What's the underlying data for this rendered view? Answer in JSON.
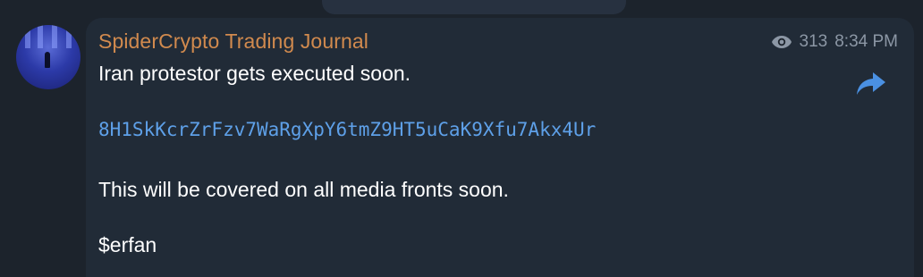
{
  "message": {
    "sender": "SpiderCrypto Trading Journal",
    "views": "313",
    "time": "8:34 PM",
    "lines": {
      "line1": "Iran protestor gets executed soon.",
      "address": "8H1SkKcrZrFzv7WaRgXpY6tmZ9HT5uCaK9Xfu7Akx4Ur",
      "line3": "This will be covered on all media fronts soon.",
      "line4": "$erfan"
    }
  },
  "icons": {
    "views": "eye-icon",
    "share": "share-arrow-icon"
  },
  "colors": {
    "background": "#1c232c",
    "bubble": "#212b37",
    "sender": "#d18a4e",
    "link": "#5ea0e8",
    "meta": "#8c97a5",
    "share": "#4a90e2"
  }
}
